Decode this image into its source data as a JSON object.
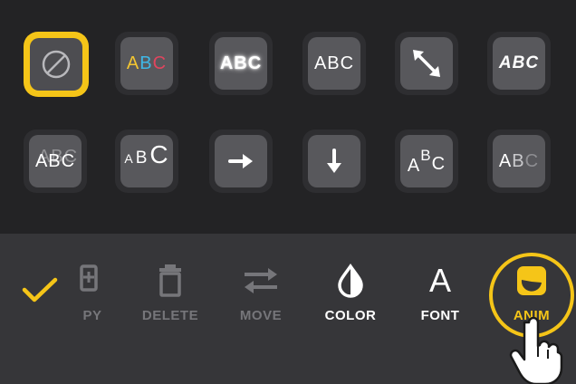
{
  "styles": {
    "row1": [
      {
        "name": "none",
        "text": ""
      },
      {
        "name": "colored-letters",
        "chars": [
          "A",
          "B",
          "C"
        ],
        "colors": [
          "#f2c531",
          "#3fb7e6",
          "#e0455e"
        ]
      },
      {
        "name": "glow",
        "text": "ABC"
      },
      {
        "name": "plain",
        "text": "ABC"
      },
      {
        "name": "expand",
        "text": ""
      },
      {
        "name": "italic-bold",
        "text": "ABC"
      }
    ],
    "row2": [
      {
        "name": "shadow",
        "text": "ABC"
      },
      {
        "name": "growing-size",
        "chars": [
          "A",
          "B",
          "C"
        ]
      },
      {
        "name": "arrow-right",
        "text": ""
      },
      {
        "name": "arrow-down",
        "text": ""
      },
      {
        "name": "wave",
        "chars": [
          "A",
          "B",
          "C"
        ]
      },
      {
        "name": "fade",
        "chars": [
          "A",
          "B",
          "C"
        ]
      }
    ]
  },
  "toolbar": {
    "copy_label": "PY",
    "delete_label": "DELETE",
    "move_label": "MOVE",
    "color_label": "COLOR",
    "font_label": "FONT",
    "font_glyph": "A",
    "anim_label": "ANIM"
  },
  "colors": {
    "accent": "#f5c518",
    "tile_bg": "#58585c",
    "toolbar_bg": "#363639",
    "grid_bg": "#232325"
  }
}
